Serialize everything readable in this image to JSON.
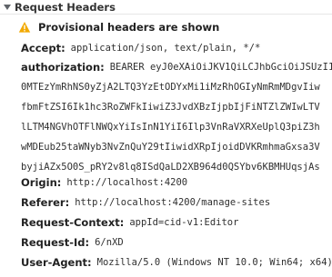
{
  "section": {
    "title": "Request Headers"
  },
  "warning": {
    "text": "Provisional headers are shown"
  },
  "headers": {
    "accept": {
      "name": "Accept:",
      "value": "application/json, text/plain, */*"
    },
    "authorization": {
      "name": "authorization:",
      "value": "BEARER eyJ0eXAiOiJKV1QiLCJhbGciOiJSUzI1",
      "continuation": [
        "0MTEzYmRhNS0yZjA2LTQ3YzEtODYxMi1iMzRhOGIyNmRmMDgvIiw",
        "fbmFtZSI6Ik1hc3RoZWFkIiwiZ3JvdXBzIjpbIjFiNTZlZWIwLTV",
        "lLTM4NGVhOTFlNWQxYiIsInN1YiI6Ilp3VnRaVXRXeUplQ3piZ3h",
        "wMDEub25taWNyb3NvZnQuY29tIiwidXRpIjoidDVKRmhmaGxsa3V",
        "byjiAZx5O0S_pRY2v8lq8ISdQaLD2XB964d0QSYbv6KBMHUqsjAs"
      ]
    },
    "origin": {
      "name": "Origin:",
      "value": "http://localhost:4200"
    },
    "referer": {
      "name": "Referer:",
      "value": "http://localhost:4200/manage-sites"
    },
    "request_context": {
      "name": "Request-Context:",
      "value": "appId=cid-v1:Editor"
    },
    "request_id": {
      "name": "Request-Id:",
      "value": "6/nXD"
    },
    "user_agent": {
      "name": "User-Agent:",
      "value": "Mozilla/5.0 (Windows NT 10.0; Win64; x64)"
    }
  },
  "colors": {
    "warning_icon": "#f2a900",
    "triangle": "#5f6368"
  },
  "icons": {
    "section_toggle": "triangle-down-icon",
    "warning": "warning-icon"
  }
}
